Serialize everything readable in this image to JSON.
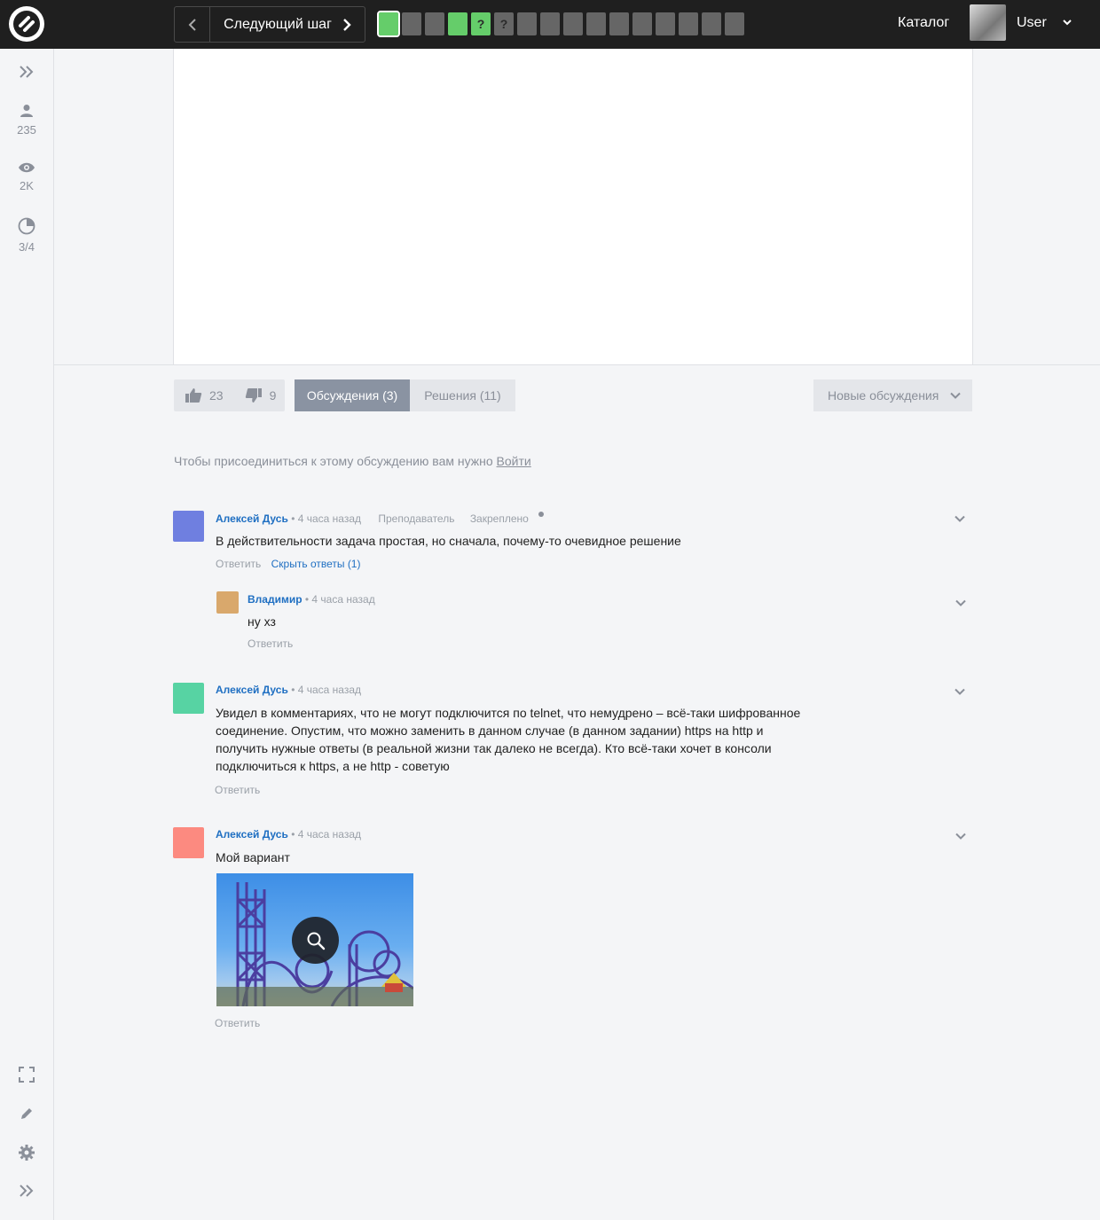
{
  "topbar": {
    "next_step_label": "Следующий шаг",
    "steps": [
      {
        "state": "done",
        "mark": "",
        "active": true
      },
      {
        "state": "todo",
        "mark": ""
      },
      {
        "state": "todo",
        "mark": ""
      },
      {
        "state": "done",
        "mark": ""
      },
      {
        "state": "done",
        "mark": "?"
      },
      {
        "state": "todo",
        "mark": "?"
      },
      {
        "state": "todo",
        "mark": ""
      },
      {
        "state": "todo",
        "mark": ""
      },
      {
        "state": "todo",
        "mark": ""
      },
      {
        "state": "todo",
        "mark": ""
      },
      {
        "state": "todo",
        "mark": ""
      },
      {
        "state": "todo",
        "mark": ""
      },
      {
        "state": "todo",
        "mark": ""
      },
      {
        "state": "todo",
        "mark": ""
      },
      {
        "state": "todo",
        "mark": ""
      },
      {
        "state": "todo",
        "mark": ""
      }
    ],
    "catalog_label": "Каталог",
    "username": "User"
  },
  "sidebar": {
    "learners": "235",
    "views": "2K",
    "progress": "3/4"
  },
  "toolbar": {
    "likes": "23",
    "dislikes": "9",
    "tab_discussions": "Обсуждения (3)",
    "tab_solutions": "Решения (11)",
    "sort_label": "Новые обсуждения"
  },
  "join": {
    "text": "Чтобы присоединиться к этому обсуждению вам нужно",
    "link": "Войти"
  },
  "comments": [
    {
      "author": "Алексей Дусь",
      "time": "• 4 часа назад",
      "role": "Преподаватель",
      "pinned": "Закреплено",
      "text": "В действительности задача простая, но сначала, почему-то очевидное решение",
      "reply": "Ответить",
      "hide_replies": "Скрыть ответы (1)",
      "avatar_color": "#6f7fe0"
    },
    {
      "author": "Владимир",
      "time": "• 4 часа назад",
      "text": "ну хз",
      "reply": "Ответить",
      "avatar_color": "#d9a86c"
    },
    {
      "author": "Алексей Дусь",
      "time": "• 4 часа назад",
      "text_lines": [
        "Увидел в комментариях, что не могут подключится по telnet, что немудрено – всё-таки шифрованное",
        "соединение. Опустим, что можно заменить в данном случае (в данном задании) https на http и",
        "получить нужные ответы (в реальной жизни так далеко не всегда). Кто всё-таки хочет в консоли",
        "подключиться к https, а не http - советую"
      ],
      "reply": "Ответить",
      "avatar_color": "#57d3a3"
    },
    {
      "author": "Алексей Дусь",
      "time": "• 4 часа назад",
      "text": "Мой вариант",
      "reply": "Ответить",
      "avatar_color": "#fc8a80"
    }
  ]
}
